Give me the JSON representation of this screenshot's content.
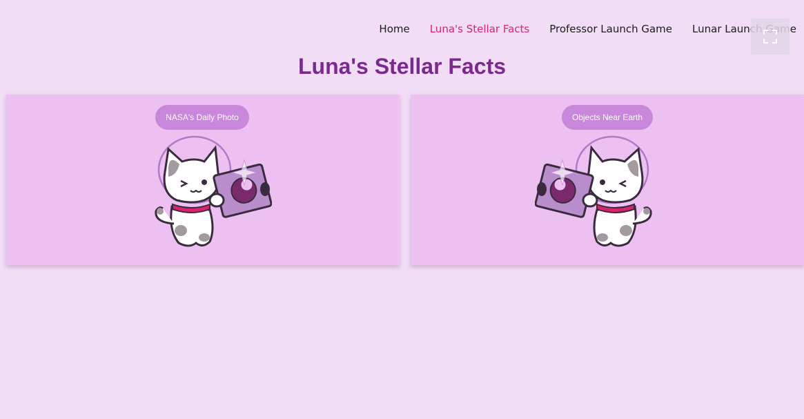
{
  "nav": {
    "items": [
      {
        "label": "Home",
        "active": false
      },
      {
        "label": "Luna's Stellar Facts",
        "active": true
      },
      {
        "label": "Professor Launch Game",
        "active": false
      },
      {
        "label": "Lunar Launch Game",
        "active": false
      }
    ],
    "fullscreen_icon": "expand-icon"
  },
  "page": {
    "title": "Luna's Stellar Facts"
  },
  "cards": [
    {
      "button_label": "NASA's Daily Photo",
      "image": "astronaut-cat-holding-photo"
    },
    {
      "button_label": "Objects Near Earth",
      "image": "astronaut-cat-holding-photo"
    }
  ],
  "colors": {
    "background": "#f1ddf5",
    "card": "#ecc0f1",
    "pill": "#c987dc",
    "title": "#7a2a8f",
    "nav_active": "#d6246e"
  }
}
